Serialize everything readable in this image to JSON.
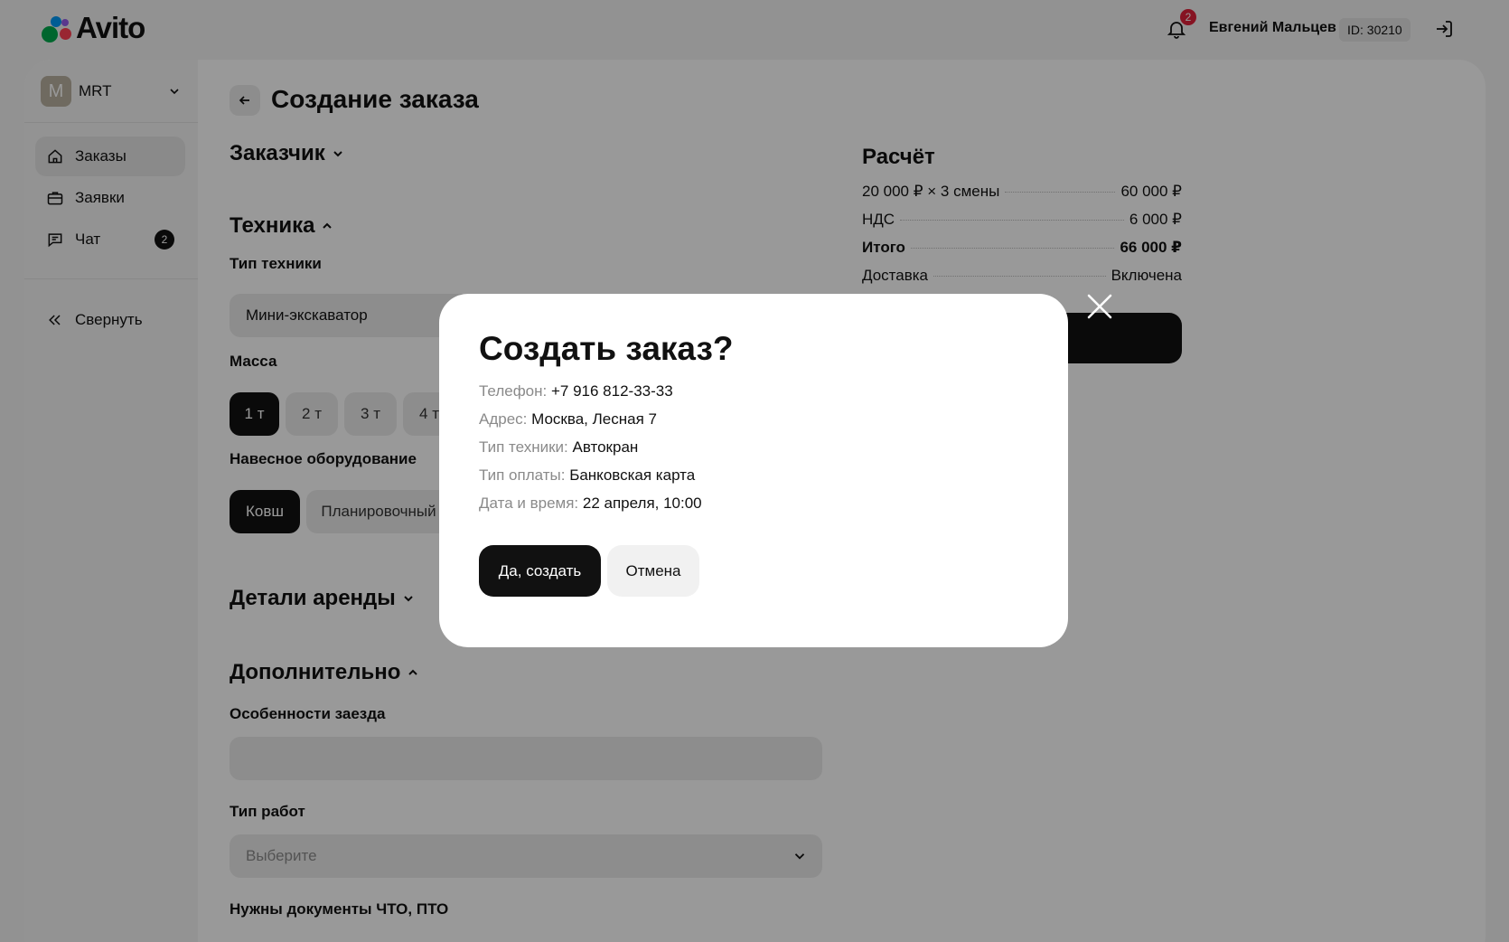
{
  "header": {
    "logo_text": "Avito",
    "notifications_count": "2",
    "user_name": "Евгений Мальцев",
    "user_id": "ID: 30210"
  },
  "sidebar": {
    "org_initial": "M",
    "org_name": "MRT",
    "items": [
      {
        "label": "Заказы",
        "icon": "home-icon",
        "active": true
      },
      {
        "label": "Заявки",
        "icon": "briefcase-icon"
      },
      {
        "label": "Чат",
        "icon": "chat-icon",
        "badge": "2"
      }
    ],
    "collapse_label": "Свернуть"
  },
  "page": {
    "title": "Создание заказа",
    "sections": {
      "customer": "Заказчик",
      "machinery": "Техника",
      "rental": "Детали аренды",
      "extra": "Дополнительно"
    },
    "machinery_type_label": "Тип техники",
    "machinery_type_value": "Мини-экскаватор",
    "mass_label": "Масса",
    "mass_options": [
      "1 т",
      "2 т",
      "3 т",
      "4 т"
    ],
    "mass_selected": "1 т",
    "attachment_label": "Навесное оборудование",
    "attachment_options": [
      "Ковш",
      "Планировочный"
    ],
    "attachment_selected": "Ковш",
    "arrival_label": "Особенности заезда",
    "arrival_value": "",
    "work_type_label": "Тип работ",
    "work_type_placeholder": "Выберите",
    "docs_label": "Нужны документы ЧТО, ПТО"
  },
  "calc": {
    "title": "Расчёт",
    "rows": [
      {
        "label": "20 000 ₽ × 3 смены",
        "value": "60 000 ₽"
      },
      {
        "label": "НДС",
        "value": "6 000 ₽"
      },
      {
        "label": "Итого",
        "value": "66 000 ₽",
        "bold": true
      },
      {
        "label": "Доставка",
        "value": "Включена"
      }
    ]
  },
  "modal": {
    "title": "Создать заказ?",
    "lines": [
      {
        "label": "Телефон:",
        "value": "+7 916 812-33-33"
      },
      {
        "label": "Адрес:",
        "value": "Москва, Лесная 7"
      },
      {
        "label": "Тип техники:",
        "value": "Автокран"
      },
      {
        "label": "Тип оплаты:",
        "value": "Банковская карта"
      },
      {
        "label": "Дата и время:",
        "value": "22 апреля, 10:00"
      }
    ],
    "confirm_label": "Да, создать",
    "cancel_label": "Отмена"
  },
  "colors": {
    "accent": "#111111",
    "badge": "#e0203a",
    "logo_green": "#00aa4e",
    "logo_blue": "#0099f7",
    "logo_red": "#ff4053",
    "logo_purple": "#965eeb"
  }
}
